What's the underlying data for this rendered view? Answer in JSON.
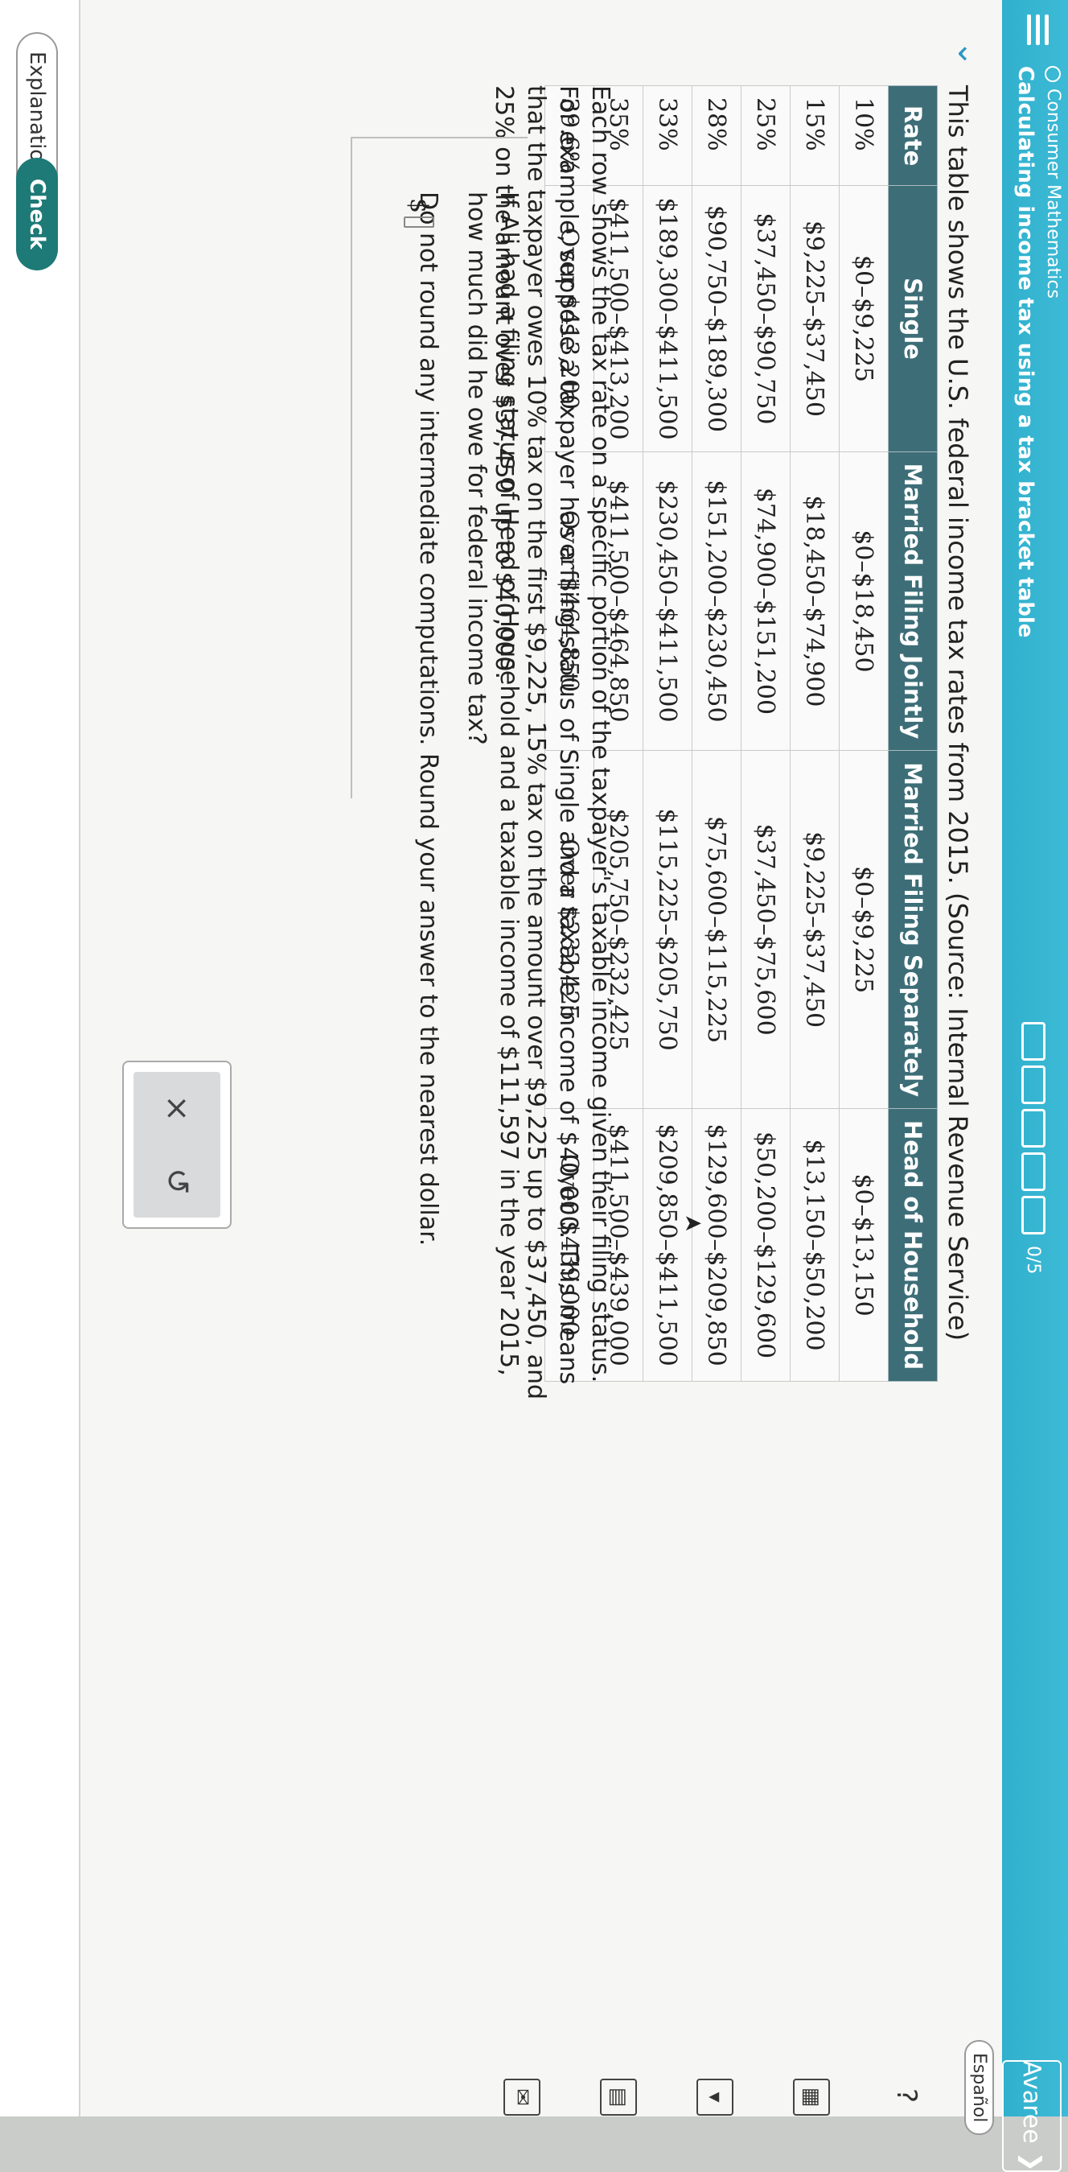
{
  "header": {
    "subject": "Consumer Mathematics",
    "title": "Calculating income tax using a tax bracket table",
    "progress_label": "0/5",
    "user_label": "Avaree",
    "user_icon": "chevron-down-icon"
  },
  "language_toggle": "Español",
  "intro": "This table shows the U.S. federal income tax rates from 2015. (Source: Internal Revenue Service)",
  "table": {
    "headers": [
      "Rate",
      "Single",
      "Married Filing Jointly",
      "Married Filing Separately",
      "Head of Household"
    ],
    "rows": [
      [
        "10%",
        "$0–$9,225",
        "$0–$18,450",
        "$0–$9,225",
        "$0–$13,150"
      ],
      [
        "15%",
        "$9,225–$37,450",
        "$18,450–$74,900",
        "$9,225–$37,450",
        "$13,150–$50,200"
      ],
      [
        "25%",
        "$37,450–$90,750",
        "$74,900–$151,200",
        "$37,450–$75,600",
        "$50,200–$129,600"
      ],
      [
        "28%",
        "$90,750–$189,300",
        "$151,200–$230,450",
        "$75,600–$115,225",
        "$129,600–$209,850"
      ],
      [
        "33%",
        "$189,300–$411,500",
        "$230,450–$411,500",
        "$115,225–$205,750",
        "$209,850–$411,500"
      ],
      [
        "35%",
        "$411,500–$413,200",
        "$411,500–$464,850",
        "$205,750–$232,425",
        "$411,500–$439,000"
      ],
      [
        "39.6%",
        "Over $413,200",
        "Over $464,850",
        "Over $232,425",
        "Over $439,000"
      ]
    ]
  },
  "explanation": "Each row shows the tax rate on a specific portion of the taxpayer's taxable income given their filing status. For example, suppose a taxpayer has a filing status of Single and a taxable income of $40,000. This means that the taxpayer owes 10% tax on the first $9,225, 15% tax on the amount over $9,225 up to $37,450, and 25% on the amount over $37,450 up to $40,000.",
  "question": {
    "text": "If Ali had a filing status of Head of Household and a taxable income of $111,597 in the year 2015, how much did he owe for federal income tax?",
    "instruction": "Do not round any intermediate computations. Round your answer to the nearest dollar.",
    "answer_prefix": "$",
    "answer_value": ""
  },
  "controls": {
    "clear_symbol": "×",
    "undo_symbol": "↺"
  },
  "side_tools": [
    "help-icon",
    "calculator-icon",
    "dropdown-icon",
    "data-table-icon",
    "mail-icon"
  ],
  "footer": {
    "explanation_label": "Explanation",
    "check_label": "Check"
  }
}
